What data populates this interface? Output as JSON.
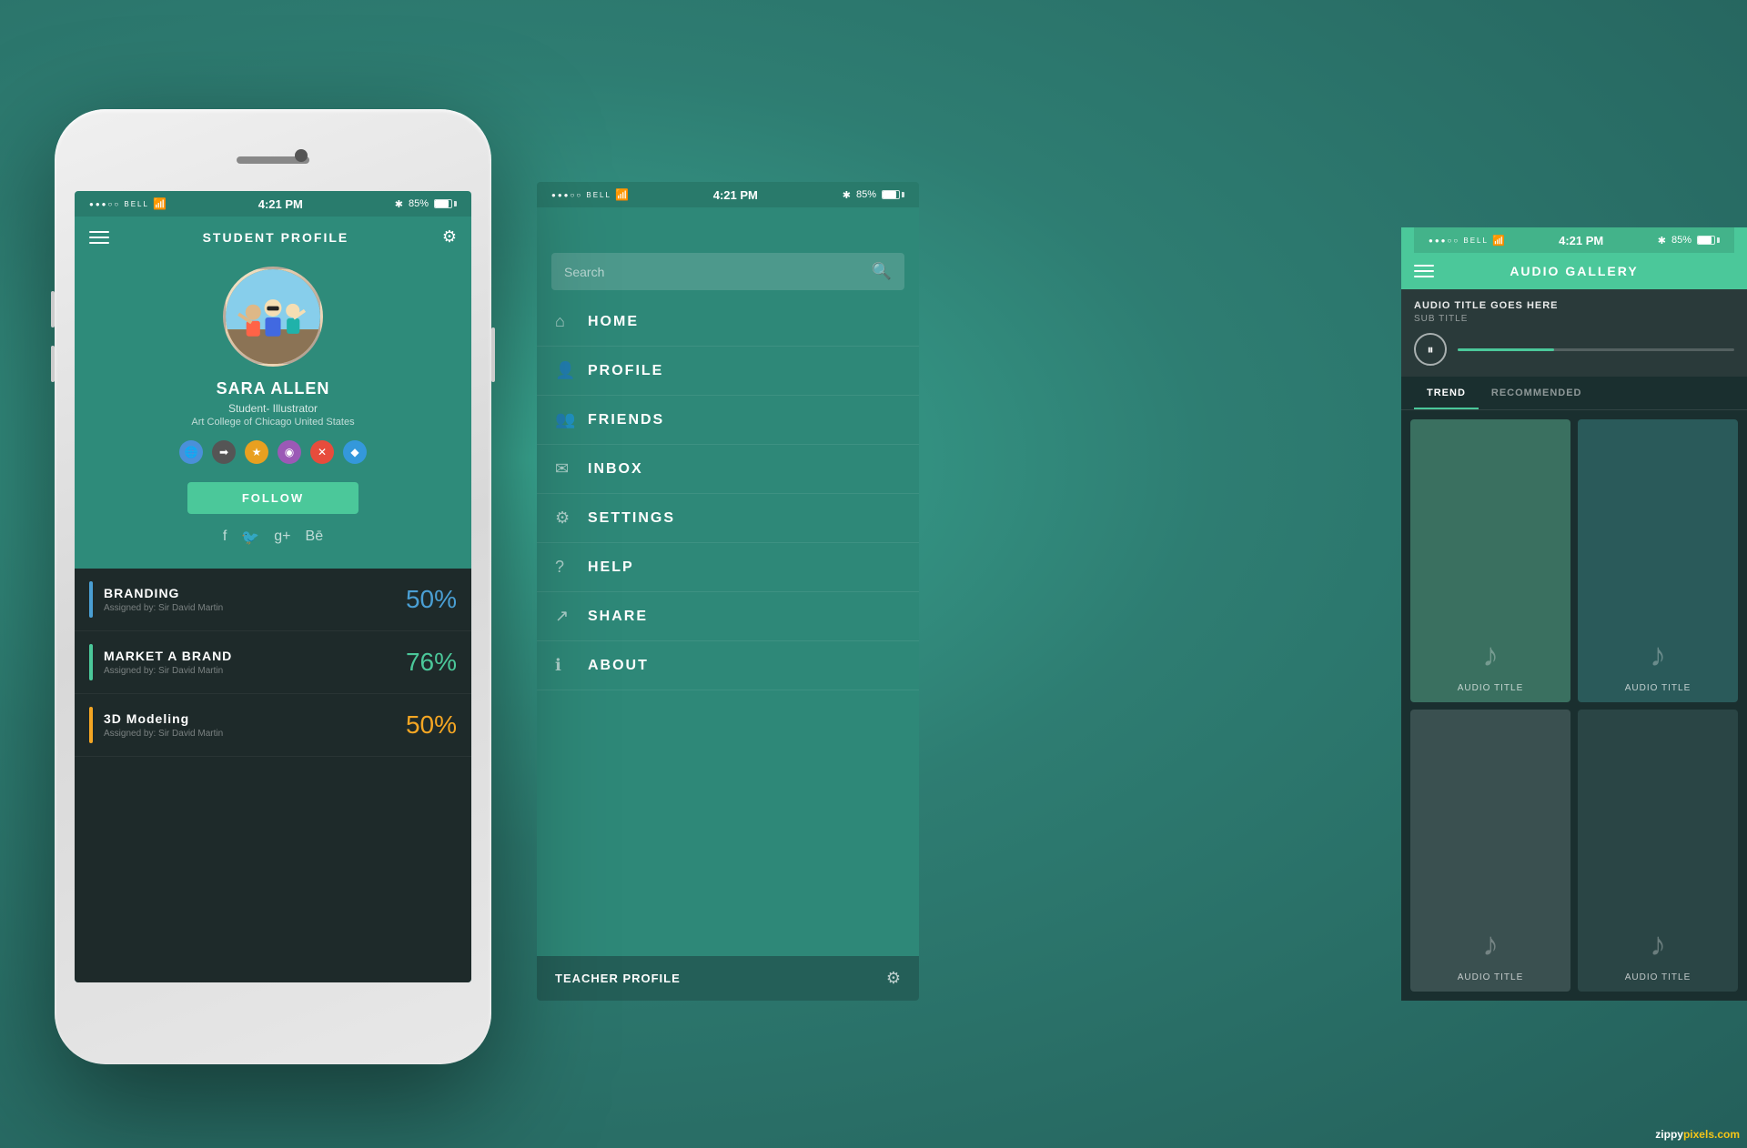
{
  "background": {
    "color": "#2e8b7a"
  },
  "phone1": {
    "status_bar": {
      "carrier": "●●●○○ BELL",
      "wifi": "WiFi",
      "time": "4:21 PM",
      "bluetooth": "BT",
      "battery": "85%"
    },
    "header": {
      "title": "STUDENT PROFILE"
    },
    "profile": {
      "name": "SARA ALLEN",
      "role": "Student- Illustrator",
      "school": "Art College of Chicago United States"
    },
    "follow_button": "FOLLOW",
    "courses": [
      {
        "title": "BRANDING",
        "assigned": "Assigned by: Sir David Martin",
        "percent": "50%",
        "color": "#4a9fd4"
      },
      {
        "title": "MARKET A BRAND",
        "assigned": "Assigned by: Sir David Martin",
        "percent": "76%",
        "color": "#4bc89a"
      },
      {
        "title": "3D Modeling",
        "assigned": "Assigned by: Sir David Martin",
        "percent": "50%",
        "color": "#f5a623"
      }
    ]
  },
  "phone2": {
    "status_bar": {
      "carrier": "●●●○○ BELL",
      "wifi": "WiFi",
      "time": "4:21 PM",
      "bluetooth": "BT",
      "battery": "85%"
    },
    "search": {
      "placeholder": "Search"
    },
    "menu_items": [
      {
        "label": "HOME",
        "icon": "🏠"
      },
      {
        "label": "PROFILE",
        "icon": "👤"
      },
      {
        "label": "FRIENDS",
        "icon": "👥"
      },
      {
        "label": "INBOX",
        "icon": "✉"
      },
      {
        "label": "SETTINGS",
        "icon": "⚙"
      },
      {
        "label": "HELP",
        "icon": "?"
      },
      {
        "label": "SHARE",
        "icon": "↗"
      },
      {
        "label": "ABOUT",
        "icon": "ℹ"
      }
    ],
    "bottom": {
      "label": "TEACHER PROFILE"
    }
  },
  "phone3": {
    "status_bar": {
      "carrier": "●●●○○ BELL",
      "wifi": "WiFi",
      "time": "4:21 PM",
      "bluetooth": "BT",
      "battery": "85%"
    },
    "header": {
      "title": "AUDIO GALLERY"
    },
    "now_playing": {
      "title": "AUDIO TITLE GOES HERE",
      "subtitle": "SUB TITLE"
    },
    "tabs": [
      {
        "label": "TREND",
        "active": true
      },
      {
        "label": "RECOMMENDED",
        "active": false
      }
    ],
    "audio_cards": [
      {
        "title": "AUDIO TITLE"
      },
      {
        "title": "AUDIO TITLE"
      },
      {
        "title": "AUDIO TITLE"
      },
      {
        "title": "AUDIO TITLE"
      }
    ]
  },
  "watermark": {
    "text1": "zippy",
    "text2": "pixels.com"
  }
}
